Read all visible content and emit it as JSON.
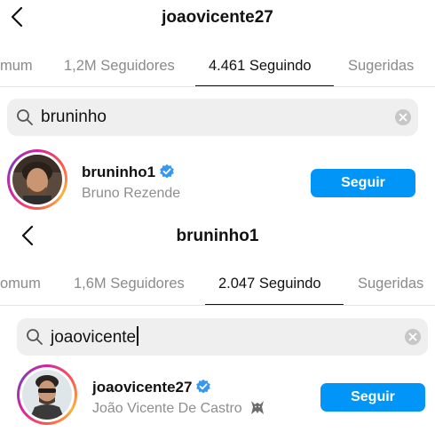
{
  "screens": [
    {
      "header": {
        "title": "joaovicente27"
      },
      "tabs": [
        {
          "label": "mum"
        },
        {
          "label": "1,2M Seguidores"
        },
        {
          "label": "4.461 Seguindo"
        },
        {
          "label": "Sugeridas"
        }
      ],
      "active_tab": 2,
      "search": {
        "value": "bruninho"
      },
      "result": {
        "username": "bruninho1",
        "full_name": "Bruno Rezende",
        "verified": true,
        "follow_label": "Seguir"
      }
    },
    {
      "header": {
        "title": "bruninho1"
      },
      "tabs": [
        {
          "label": "omum"
        },
        {
          "label": "1,6M Seguidores"
        },
        {
          "label": "2.047 Seguindo"
        },
        {
          "label": "Sugeridas"
        }
      ],
      "active_tab": 2,
      "search": {
        "value": "joaovicente"
      },
      "result": {
        "username": "joaovicente27",
        "full_name": "João Vicente De Castro",
        "verified": true,
        "follow_label": "Seguir",
        "name_emoji": "wolf-icon"
      }
    }
  ],
  "colors": {
    "follow_button": "#0095f6",
    "verified_badge": "#3897f0",
    "search_background": "#efefef",
    "secondary_text": "#8e8e8e"
  }
}
